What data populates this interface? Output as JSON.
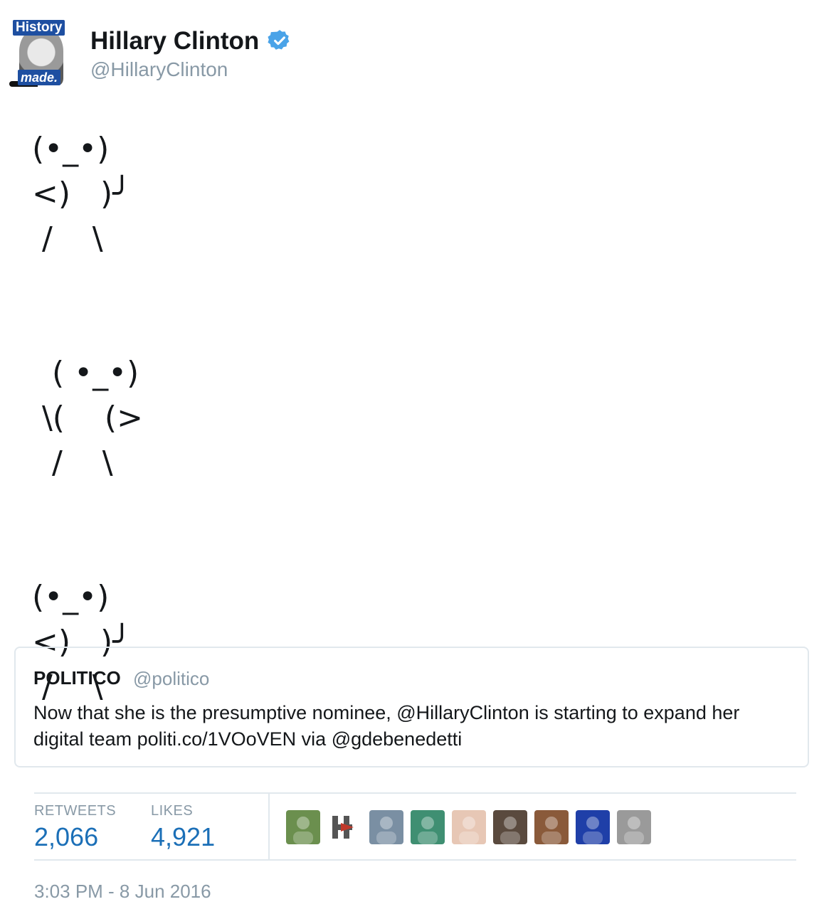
{
  "header": {
    "avatar_text_top": "History",
    "avatar_text_bottom": "made.",
    "name": "Hillary Clinton",
    "handle": "@HillaryClinton",
    "verified_icon": "verified-badge-icon"
  },
  "tweet": {
    "ascii_art": "(•_•)\n<)   )╯\n /    \\\n\n\n  ( •_•)\n \\(    (>\n  /    \\\n\n\n(•_•)\n<)   )╯\n /    \\"
  },
  "quoted_tweet": {
    "name": "POLITICO",
    "handle": "@politico",
    "text": "Now that she is the presumptive nominee, @HillaryClinton is starting to expand her digital team politi.co/1VOoVEN via @gdebenedetti"
  },
  "stats": {
    "retweets_label": "RETWEETS",
    "retweets_value": "2,066",
    "likes_label": "LIKES",
    "likes_value": "4,921"
  },
  "likers": [
    {
      "name": "liker-avatar-1",
      "color": "#6b8f4e"
    },
    {
      "name": "liker-avatar-2",
      "color": "#ffffff"
    },
    {
      "name": "liker-avatar-3",
      "color": "#7a8fa3"
    },
    {
      "name": "liker-avatar-4",
      "color": "#3f8f72"
    },
    {
      "name": "liker-avatar-5",
      "color": "#e7c7b5"
    },
    {
      "name": "liker-avatar-6",
      "color": "#5a4a3e"
    },
    {
      "name": "liker-avatar-7",
      "color": "#8a5a3a"
    },
    {
      "name": "liker-avatar-8",
      "color": "#1f3fa8"
    },
    {
      "name": "liker-avatar-9",
      "color": "#9a9a9a"
    }
  ],
  "timestamp": "3:03 PM - 8 Jun 2016"
}
